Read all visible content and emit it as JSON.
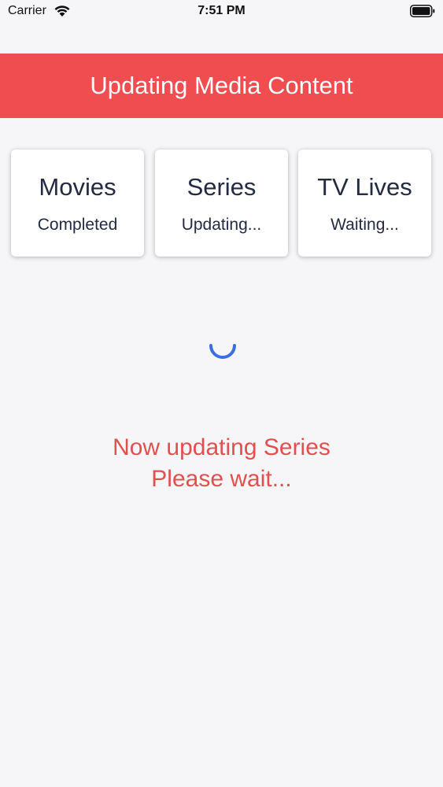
{
  "status_bar": {
    "carrier": "Carrier",
    "time": "7:51 PM",
    "wifi_icon": "wifi-icon",
    "battery_icon": "battery-full-icon"
  },
  "header": {
    "title": "Updating Media Content",
    "background": "#ef4d4f"
  },
  "categories": [
    {
      "name": "Movies",
      "status": "Completed"
    },
    {
      "name": "Series",
      "status": "Updating..."
    },
    {
      "name": "TV Lives",
      "status": "Waiting..."
    }
  ],
  "progress": {
    "spinner_icon": "loading-spinner-icon",
    "spinner_color": "#3a6fe0"
  },
  "message": {
    "line1": "Now updating Series",
    "line2": "Please wait...",
    "color": "#e0504e"
  }
}
